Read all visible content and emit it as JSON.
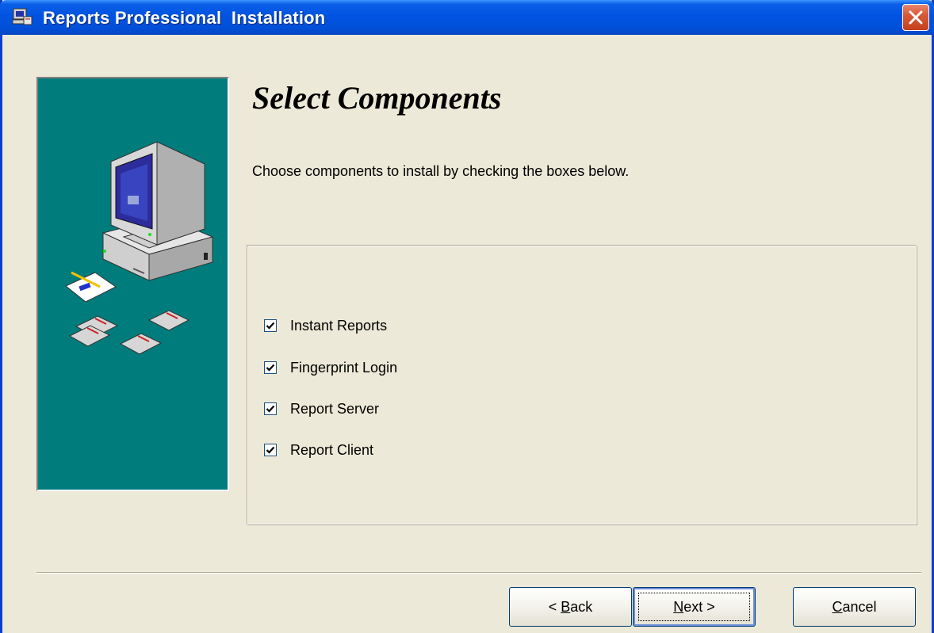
{
  "window": {
    "title": "Reports Professional  Installation",
    "close_label": "Close"
  },
  "page": {
    "heading": "Select Components",
    "description": "Choose components to install by checking the boxes below."
  },
  "components": [
    {
      "label": "Instant Reports",
      "checked": true
    },
    {
      "label": "Fingerprint Login",
      "checked": true
    },
    {
      "label": "Report Server",
      "checked": true
    },
    {
      "label": "Report Client",
      "checked": true
    }
  ],
  "buttons": {
    "back": {
      "prefix": "< ",
      "mnemonic": "B",
      "rest": "ack"
    },
    "next": {
      "mnemonic": "N",
      "rest": "ext >"
    },
    "cancel": {
      "mnemonic": "C",
      "rest": "ancel"
    }
  },
  "colors": {
    "titlebar": "#0053e1",
    "dialog_bg": "#ece9d8",
    "art_bg": "#007c7c",
    "close_button": "#d65a36"
  },
  "icons": {
    "title": "installer-icon",
    "close": "close-icon",
    "art": "computer-illustration"
  }
}
